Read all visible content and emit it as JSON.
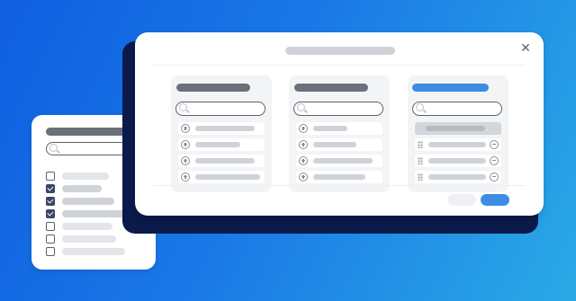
{
  "colors": {
    "background_start": "#0f5fe0",
    "background_end": "#2aa9e6",
    "accent": "#3e8de3",
    "checkbox_checked": "#3b4566",
    "shadow_card": "#0a1a4a"
  },
  "filter_panel": {
    "checkboxes": [
      {
        "checked": false
      },
      {
        "checked": true
      },
      {
        "checked": true
      },
      {
        "checked": true
      },
      {
        "checked": false
      },
      {
        "checked": false
      },
      {
        "checked": false
      }
    ]
  },
  "dialog": {
    "close_icon": "✕",
    "columns": [
      {
        "name": "available-1",
        "header_style": "dark",
        "items": 4,
        "item_icon": "plus-icon"
      },
      {
        "name": "available-2",
        "header_style": "dark",
        "items": 4,
        "item_icon": "plus-icon"
      },
      {
        "name": "selected",
        "header_style": "blue",
        "items": 3,
        "item_icon": "minus-icon"
      }
    ]
  }
}
